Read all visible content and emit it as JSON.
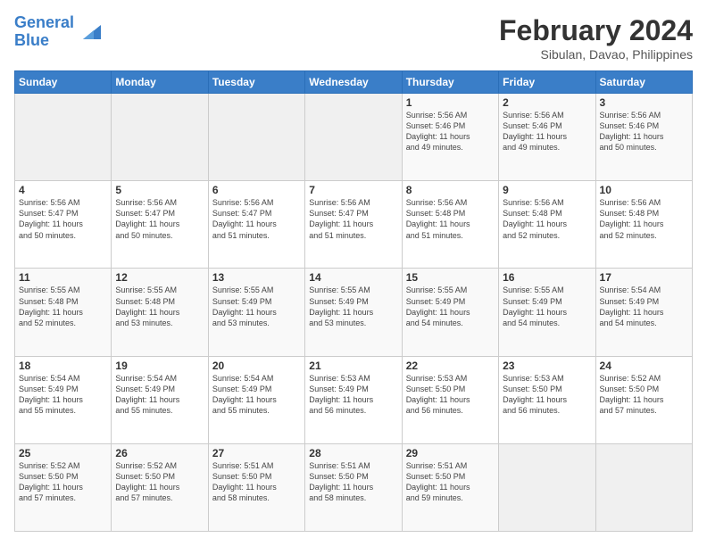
{
  "logo": {
    "line1": "General",
    "line2": "Blue"
  },
  "title": "February 2024",
  "location": "Sibulan, Davao, Philippines",
  "headers": [
    "Sunday",
    "Monday",
    "Tuesday",
    "Wednesday",
    "Thursday",
    "Friday",
    "Saturday"
  ],
  "weeks": [
    [
      {
        "num": "",
        "info": ""
      },
      {
        "num": "",
        "info": ""
      },
      {
        "num": "",
        "info": ""
      },
      {
        "num": "",
        "info": ""
      },
      {
        "num": "1",
        "info": "Sunrise: 5:56 AM\nSunset: 5:46 PM\nDaylight: 11 hours\nand 49 minutes."
      },
      {
        "num": "2",
        "info": "Sunrise: 5:56 AM\nSunset: 5:46 PM\nDaylight: 11 hours\nand 49 minutes."
      },
      {
        "num": "3",
        "info": "Sunrise: 5:56 AM\nSunset: 5:46 PM\nDaylight: 11 hours\nand 50 minutes."
      }
    ],
    [
      {
        "num": "4",
        "info": "Sunrise: 5:56 AM\nSunset: 5:47 PM\nDaylight: 11 hours\nand 50 minutes."
      },
      {
        "num": "5",
        "info": "Sunrise: 5:56 AM\nSunset: 5:47 PM\nDaylight: 11 hours\nand 50 minutes."
      },
      {
        "num": "6",
        "info": "Sunrise: 5:56 AM\nSunset: 5:47 PM\nDaylight: 11 hours\nand 51 minutes."
      },
      {
        "num": "7",
        "info": "Sunrise: 5:56 AM\nSunset: 5:47 PM\nDaylight: 11 hours\nand 51 minutes."
      },
      {
        "num": "8",
        "info": "Sunrise: 5:56 AM\nSunset: 5:48 PM\nDaylight: 11 hours\nand 51 minutes."
      },
      {
        "num": "9",
        "info": "Sunrise: 5:56 AM\nSunset: 5:48 PM\nDaylight: 11 hours\nand 52 minutes."
      },
      {
        "num": "10",
        "info": "Sunrise: 5:56 AM\nSunset: 5:48 PM\nDaylight: 11 hours\nand 52 minutes."
      }
    ],
    [
      {
        "num": "11",
        "info": "Sunrise: 5:55 AM\nSunset: 5:48 PM\nDaylight: 11 hours\nand 52 minutes."
      },
      {
        "num": "12",
        "info": "Sunrise: 5:55 AM\nSunset: 5:48 PM\nDaylight: 11 hours\nand 53 minutes."
      },
      {
        "num": "13",
        "info": "Sunrise: 5:55 AM\nSunset: 5:49 PM\nDaylight: 11 hours\nand 53 minutes."
      },
      {
        "num": "14",
        "info": "Sunrise: 5:55 AM\nSunset: 5:49 PM\nDaylight: 11 hours\nand 53 minutes."
      },
      {
        "num": "15",
        "info": "Sunrise: 5:55 AM\nSunset: 5:49 PM\nDaylight: 11 hours\nand 54 minutes."
      },
      {
        "num": "16",
        "info": "Sunrise: 5:55 AM\nSunset: 5:49 PM\nDaylight: 11 hours\nand 54 minutes."
      },
      {
        "num": "17",
        "info": "Sunrise: 5:54 AM\nSunset: 5:49 PM\nDaylight: 11 hours\nand 54 minutes."
      }
    ],
    [
      {
        "num": "18",
        "info": "Sunrise: 5:54 AM\nSunset: 5:49 PM\nDaylight: 11 hours\nand 55 minutes."
      },
      {
        "num": "19",
        "info": "Sunrise: 5:54 AM\nSunset: 5:49 PM\nDaylight: 11 hours\nand 55 minutes."
      },
      {
        "num": "20",
        "info": "Sunrise: 5:54 AM\nSunset: 5:49 PM\nDaylight: 11 hours\nand 55 minutes."
      },
      {
        "num": "21",
        "info": "Sunrise: 5:53 AM\nSunset: 5:49 PM\nDaylight: 11 hours\nand 56 minutes."
      },
      {
        "num": "22",
        "info": "Sunrise: 5:53 AM\nSunset: 5:50 PM\nDaylight: 11 hours\nand 56 minutes."
      },
      {
        "num": "23",
        "info": "Sunrise: 5:53 AM\nSunset: 5:50 PM\nDaylight: 11 hours\nand 56 minutes."
      },
      {
        "num": "24",
        "info": "Sunrise: 5:52 AM\nSunset: 5:50 PM\nDaylight: 11 hours\nand 57 minutes."
      }
    ],
    [
      {
        "num": "25",
        "info": "Sunrise: 5:52 AM\nSunset: 5:50 PM\nDaylight: 11 hours\nand 57 minutes."
      },
      {
        "num": "26",
        "info": "Sunrise: 5:52 AM\nSunset: 5:50 PM\nDaylight: 11 hours\nand 57 minutes."
      },
      {
        "num": "27",
        "info": "Sunrise: 5:51 AM\nSunset: 5:50 PM\nDaylight: 11 hours\nand 58 minutes."
      },
      {
        "num": "28",
        "info": "Sunrise: 5:51 AM\nSunset: 5:50 PM\nDaylight: 11 hours\nand 58 minutes."
      },
      {
        "num": "29",
        "info": "Sunrise: 5:51 AM\nSunset: 5:50 PM\nDaylight: 11 hours\nand 59 minutes."
      },
      {
        "num": "",
        "info": ""
      },
      {
        "num": "",
        "info": ""
      }
    ]
  ]
}
